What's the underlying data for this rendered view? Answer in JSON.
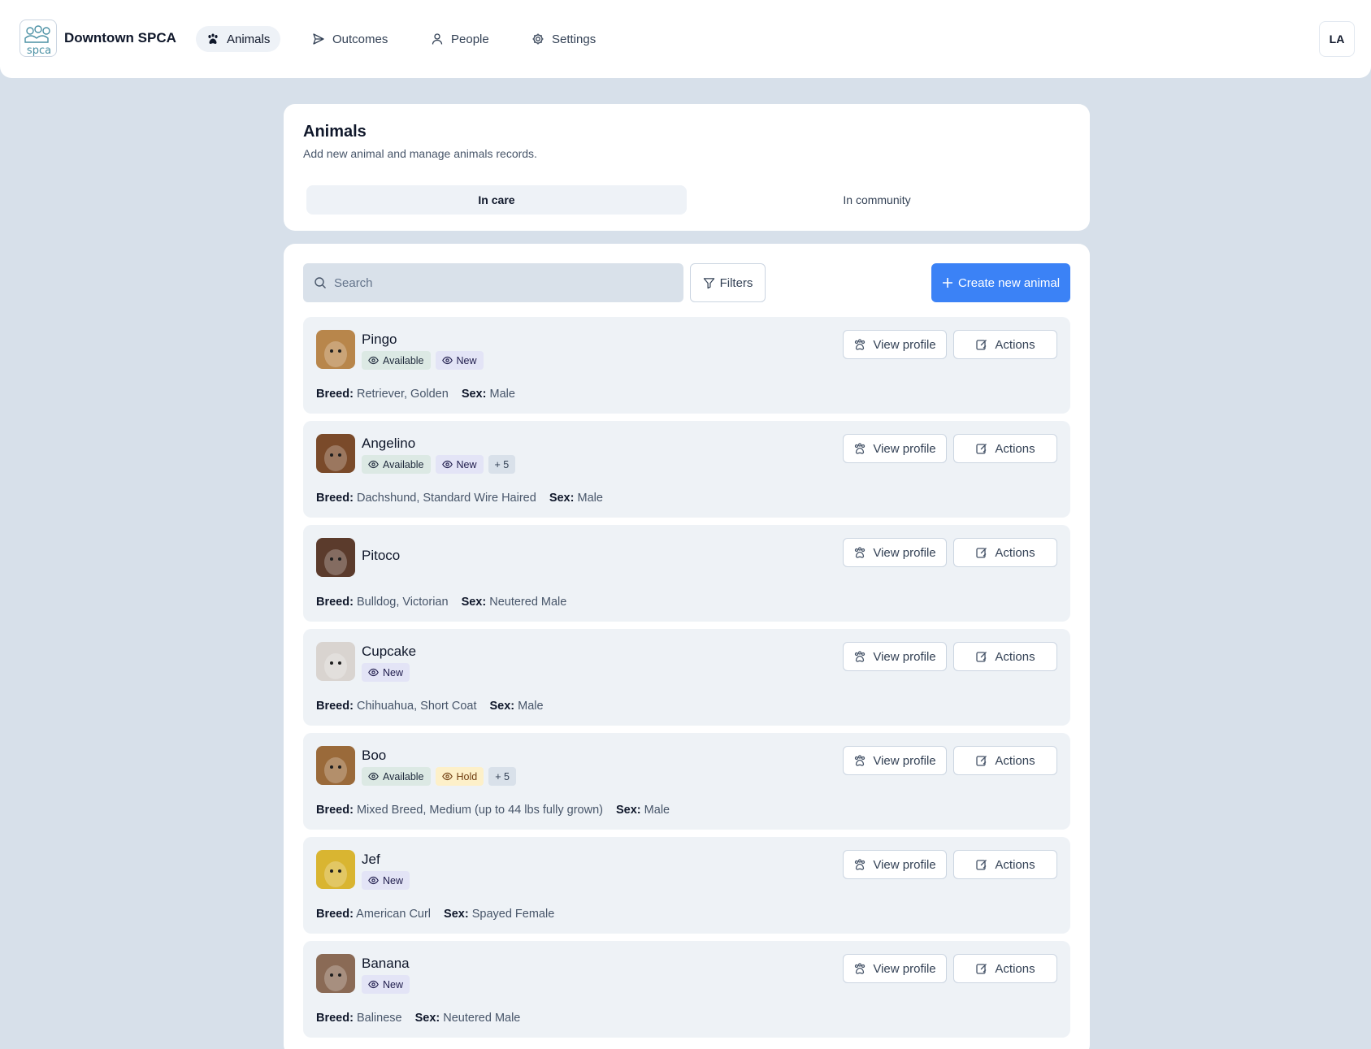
{
  "org": {
    "name": "Downtown SPCA",
    "logo_text": "spca"
  },
  "nav": [
    {
      "label": "Animals",
      "icon": "paw-icon",
      "active": true
    },
    {
      "label": "Outcomes",
      "icon": "send-icon",
      "active": false
    },
    {
      "label": "People",
      "icon": "user-icon",
      "active": false
    },
    {
      "label": "Settings",
      "icon": "gear-icon",
      "active": false
    }
  ],
  "user": {
    "initials": "LA"
  },
  "header": {
    "title": "Animals",
    "subtitle": "Add new animal and manage animals records.",
    "tabs": [
      {
        "label": "In care",
        "active": true
      },
      {
        "label": "In community",
        "active": false
      }
    ]
  },
  "toolbar": {
    "search_placeholder": "Search",
    "filters_label": "Filters",
    "create_label": "Create new animal"
  },
  "row_buttons": {
    "view_label": "View profile",
    "actions_label": "Actions"
  },
  "labels": {
    "breed": "Breed:",
    "sex": "Sex:"
  },
  "animals": [
    {
      "name": "Pingo",
      "badges": [
        "Available",
        "New"
      ],
      "breed": "Retriever, Golden",
      "sex": "Male",
      "thumb_color": "#b8864b"
    },
    {
      "name": "Angelino",
      "badges": [
        "Available",
        "New",
        "+ 5"
      ],
      "breed": "Dachshund, Standard Wire Haired",
      "sex": "Male",
      "thumb_color": "#7a4a2a"
    },
    {
      "name": "Pitoco",
      "badges": [],
      "breed": "Bulldog, Victorian",
      "sex": "Neutered Male",
      "thumb_color": "#5b3b2c"
    },
    {
      "name": "Cupcake",
      "badges": [
        "New"
      ],
      "breed": "Chihuahua, Short Coat",
      "sex": "Male",
      "thumb_color": "#d9d4d0"
    },
    {
      "name": "Boo",
      "badges": [
        "Available",
        "Hold",
        "+ 5"
      ],
      "breed": "Mixed Breed, Medium (up to 44 lbs fully grown)",
      "sex": "Male",
      "thumb_color": "#9a6a3a"
    },
    {
      "name": "Jef",
      "badges": [
        "New"
      ],
      "breed": "American Curl",
      "sex": "Spayed Female",
      "thumb_color": "#d9b531"
    },
    {
      "name": "Banana",
      "badges": [
        "New"
      ],
      "breed": "Balinese",
      "sex": "Neutered Male",
      "thumb_color": "#8a6a55"
    }
  ],
  "colors": {
    "accent": "#3b82f6",
    "background": "#d7e0ea",
    "available": "#dce9e4",
    "new": "#e3e4f6",
    "hold": "#fdf0c9"
  }
}
